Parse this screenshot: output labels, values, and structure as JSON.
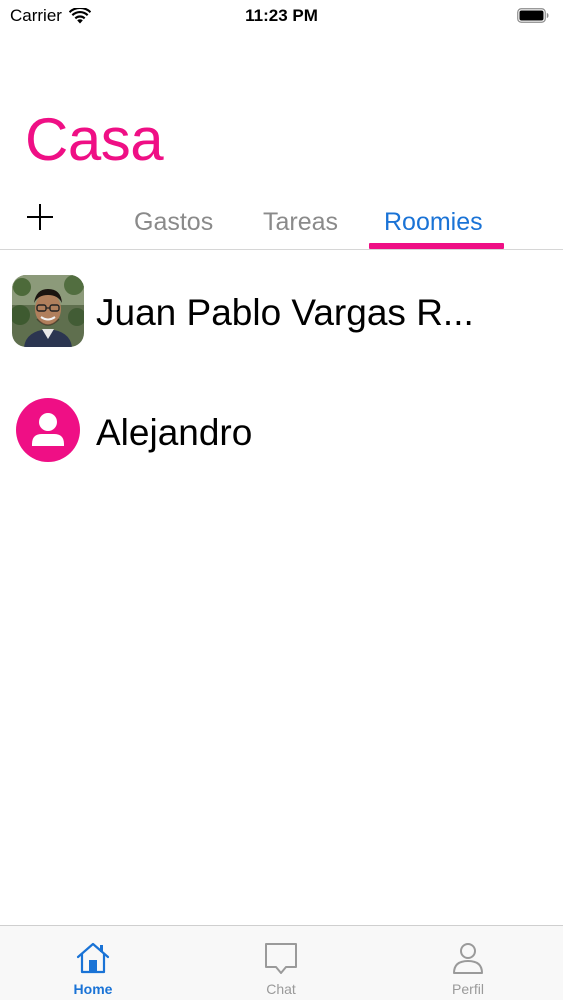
{
  "status_bar": {
    "carrier": "Carrier",
    "time": "11:23 PM",
    "wifi_icon": "wifi-icon",
    "battery_icon": "battery-icon"
  },
  "header": {
    "title": "Casa",
    "title_color": "#ef0f85"
  },
  "tabs": {
    "add_icon": "plus-icon",
    "items": [
      {
        "label": "Gastos",
        "selected": false
      },
      {
        "label": "Tareas",
        "selected": false
      },
      {
        "label": "Roomies",
        "selected": true
      }
    ],
    "selected_color": "#1a73d6",
    "indicator_color": "#ef0f85"
  },
  "roomies": [
    {
      "name": "Juan Pablo Vargas R...",
      "avatar": "profile-photo"
    },
    {
      "name": "Alejandro",
      "avatar": "person-icon"
    }
  ],
  "tab_bar": {
    "items": [
      {
        "label": "Home",
        "icon": "house-icon",
        "active": true
      },
      {
        "label": "Chat",
        "icon": "chat-bubble-icon",
        "active": false
      },
      {
        "label": "Perfil",
        "icon": "person-outline-icon",
        "active": false
      }
    ],
    "active_color": "#1a73d6",
    "inactive_color": "#9a9a9a"
  }
}
